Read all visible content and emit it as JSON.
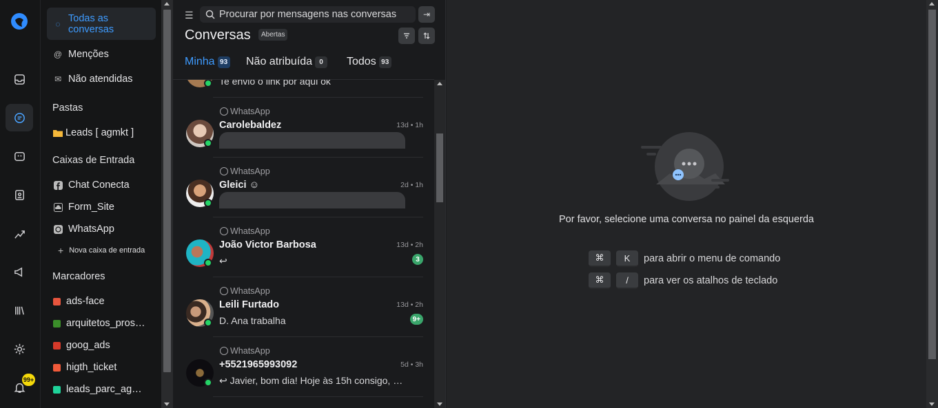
{
  "rail": {
    "notifications_badge": "99+"
  },
  "sidebar": {
    "all_conversations": "Todas as conversas",
    "mentions": "Menções",
    "unattended": "Não atendidas",
    "folders_heading": "Pastas",
    "folders": [
      {
        "label": "Leads [ agmkt ]"
      }
    ],
    "inboxes_heading": "Caixas de Entrada",
    "inboxes": [
      {
        "label": "Chat Conecta",
        "icon": "facebook-icon"
      },
      {
        "label": "Form_Site",
        "icon": "cloud-icon"
      },
      {
        "label": "WhatsApp",
        "icon": "whatsapp-icon"
      }
    ],
    "new_inbox": "Nova caixa de entrada",
    "labels_heading": "Marcadores",
    "labels": [
      {
        "label": "ads-face",
        "color": "#e8553e"
      },
      {
        "label": "arquitetos_pros…",
        "color": "#3b8e2a"
      },
      {
        "label": "goog_ads",
        "color": "#d63a2a"
      },
      {
        "label": "higth_ticket",
        "color": "#f15a3a"
      },
      {
        "label": "leads_parc_ag…",
        "color": "#1fd39a"
      }
    ]
  },
  "list": {
    "search_placeholder": "Procurar por mensagens nas conversas",
    "title": "Conversas",
    "status": "Abertas",
    "tabs": [
      {
        "label": "Minha",
        "count": "93"
      },
      {
        "label": "Não atribuída",
        "count": "0"
      },
      {
        "label": "Todos",
        "count": "93"
      }
    ],
    "partial_top_message": "Te envio o link por aqui ok",
    "conversations": [
      {
        "channel": "WhatsApp",
        "name": "Carolebaldez",
        "time": "13d • 1h",
        "message": "",
        "unread": ""
      },
      {
        "channel": "WhatsApp",
        "name": "Gleici ☺",
        "time": "2d • 1h",
        "message": "",
        "unread": ""
      },
      {
        "channel": "WhatsApp",
        "name": "João Victor Barbosa",
        "time": "13d • 2h",
        "message": "↩",
        "unread": "3"
      },
      {
        "channel": "WhatsApp",
        "name": "Leili Furtado",
        "time": "13d • 2h",
        "message": "D. Ana trabalha",
        "unread": "9+"
      },
      {
        "channel": "WhatsApp",
        "name": "+5521965993092",
        "time": "5d • 3h",
        "message": "↩ Javier, bom dia! Hoje às 15h consigo, …",
        "unread": ""
      }
    ]
  },
  "main": {
    "empty_message": "Por favor, selecione uma conversa no painel da esquerda",
    "shortcuts": [
      {
        "key1": "⌘",
        "key2": "K",
        "desc": "para abrir o menu de comando"
      },
      {
        "key1": "⌘",
        "key2": "/",
        "desc": "para ver os atalhos de teclado"
      }
    ]
  }
}
